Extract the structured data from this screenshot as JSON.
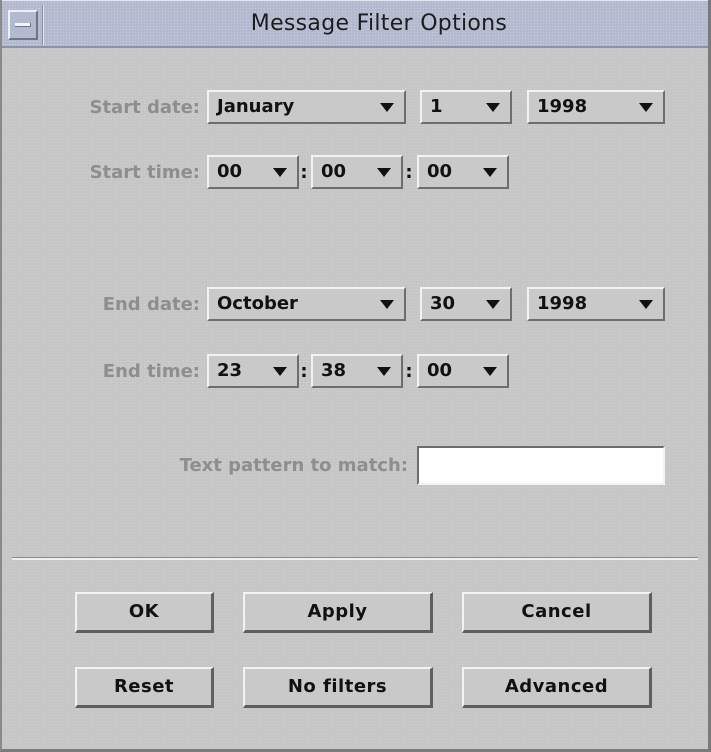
{
  "window": {
    "title": "Message Filter Options"
  },
  "start": {
    "date_label": "Start date:",
    "month": "January",
    "day": "1",
    "year": "1998",
    "time_label": "Start time:",
    "hour": "00",
    "minute": "00",
    "second": "00"
  },
  "end": {
    "date_label": "End date:",
    "month": "October",
    "day": "30",
    "year": "1998",
    "time_label": "End time:",
    "hour": "23",
    "minute": "38",
    "second": "00"
  },
  "separator": ":",
  "pattern": {
    "label": "Text pattern to match:",
    "value": ""
  },
  "buttons": {
    "ok": "OK",
    "apply": "Apply",
    "cancel": "Cancel",
    "reset": "Reset",
    "no_filters": "No filters",
    "advanced": "Advanced"
  },
  "icons": {
    "window_menu": "window-menu-icon",
    "dropdown": "triangle-down-icon"
  }
}
